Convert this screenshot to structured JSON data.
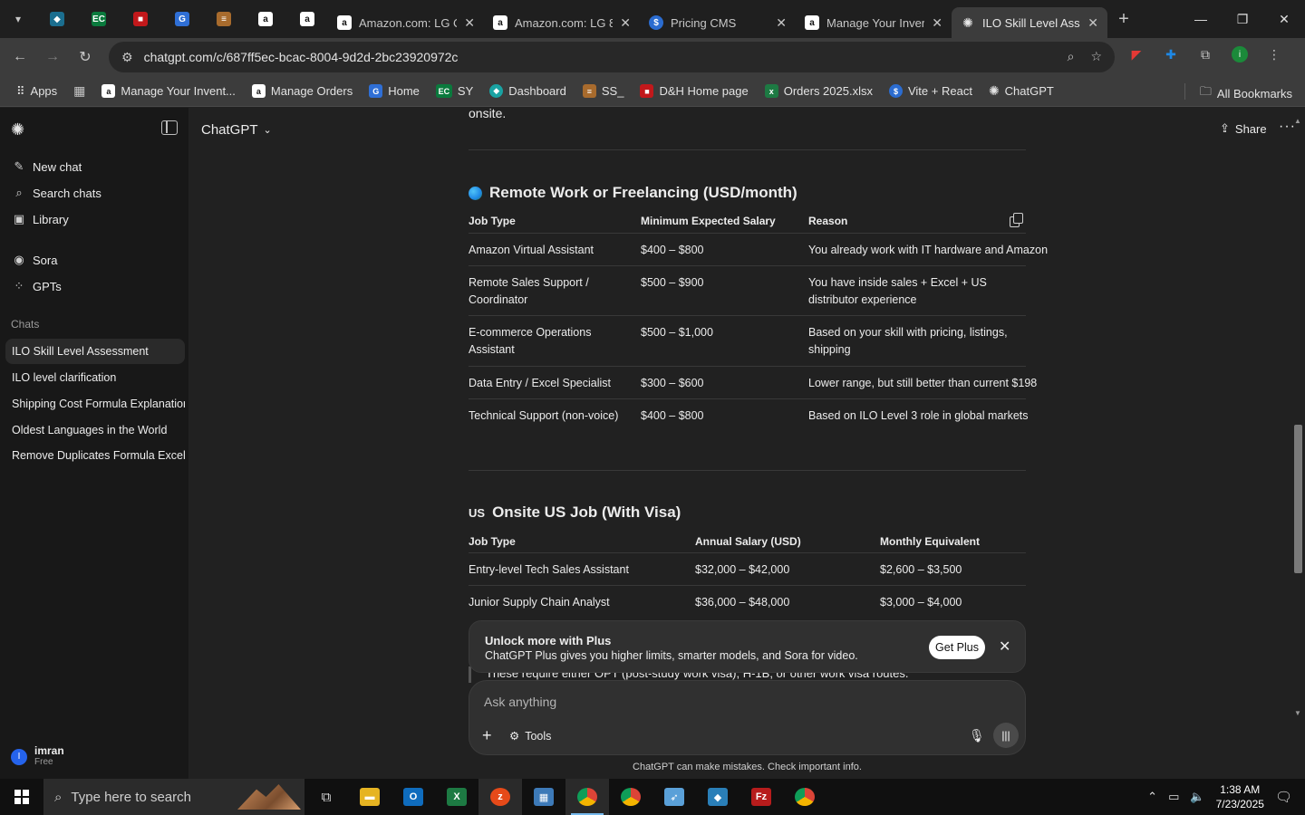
{
  "browser": {
    "tabs": [
      {
        "title": "Amazon.com: LG C",
        "icon": "amazon-icon",
        "active": false
      },
      {
        "title": "Amazon.com: LG 8",
        "icon": "amazon-icon",
        "active": false
      },
      {
        "title": "Pricing CMS",
        "icon": "dollar-icon",
        "active": false
      },
      {
        "title": "Manage Your Inver",
        "icon": "amazon-icon",
        "active": false
      },
      {
        "title": "ILO Skill Level Asse",
        "icon": "chatgpt-icon",
        "active": true
      }
    ],
    "url": "chatgpt.com/c/687ff5ec-bcac-8004-9d2d-2bc23920972c",
    "bookmarks": [
      {
        "label": "Apps",
        "icon": "apps-icon"
      },
      {
        "label": "Manage Your Invent...",
        "icon": "amazon-icon"
      },
      {
        "label": "Manage Orders",
        "icon": "amazon-icon"
      },
      {
        "label": "Home",
        "icon": "home-icon"
      },
      {
        "label": "SY",
        "icon": "ec-icon"
      },
      {
        "label": "Dashboard",
        "icon": "dashboard-icon"
      },
      {
        "label": "SS_",
        "icon": "ss-icon"
      },
      {
        "label": "D&H Home page",
        "icon": "dh-icon"
      },
      {
        "label": "Orders 2025.xlsx",
        "icon": "excel-icon"
      },
      {
        "label": "Vite + React",
        "icon": "vite-icon"
      },
      {
        "label": "ChatGPT",
        "icon": "chatgpt-icon"
      }
    ],
    "all_bookmarks": "All Bookmarks"
  },
  "sidebar": {
    "new_chat": "New chat",
    "search_chats": "Search chats",
    "library": "Library",
    "sora": "Sora",
    "gpts": "GPTs",
    "chats_label": "Chats",
    "chats": [
      "ILO Skill Level Assessment",
      "ILO level clarification",
      "Shipping Cost Formula Explanation",
      "Oldest Languages in the World",
      "Remove Duplicates Formula Excel"
    ],
    "user_initial": "I",
    "user_name": "imran",
    "user_plan": "Free"
  },
  "header": {
    "model": "ChatGPT",
    "share": "Share"
  },
  "content": {
    "fragment": "onsite.",
    "remote": {
      "title": "Remote Work or Freelancing (USD/month)",
      "headers": [
        "Job Type",
        "Minimum Expected Salary",
        "Reason"
      ],
      "rows": [
        [
          "Amazon Virtual Assistant",
          "$400 – $800",
          "You already work with IT hardware and Amazon"
        ],
        [
          "Remote Sales Support / Coordinator",
          "$500 – $900",
          "You have inside sales + Excel + US distributor experience"
        ],
        [
          "E-commerce Operations Assistant",
          "$500 – $1,000",
          "Based on your skill with pricing, listings, shipping"
        ],
        [
          "Data Entry / Excel Specialist",
          "$300 – $600",
          "Lower range, but still better than current $198"
        ],
        [
          "Technical Support (non-voice)",
          "$400 – $800",
          "Based on ILO Level 3 role in global markets"
        ]
      ]
    },
    "onsite": {
      "flag": "US",
      "title": "Onsite US Job (With Visa)",
      "headers": [
        "Job Type",
        "Annual Salary (USD)",
        "Monthly Equivalent"
      ],
      "rows": [
        [
          "Entry-level Tech Sales Assistant",
          "$32,000 – $42,000",
          "$2,600 – $3,500"
        ],
        [
          "Junior Supply Chain Analyst",
          "$36,000 – $48,000",
          "$3,000 – $4,000"
        ]
      ]
    },
    "peek_text": "These require either OPT (post-study work visa), H-1B, or other work visa routes."
  },
  "upsell": {
    "title": "Unlock more with Plus",
    "subtitle": "ChatGPT Plus gives you higher limits, smarter models, and Sora for video.",
    "button": "Get Plus"
  },
  "composer": {
    "placeholder": "Ask anything",
    "tools": "Tools"
  },
  "disclaimer": "ChatGPT can make mistakes. Check important info.",
  "taskbar": {
    "search_placeholder": "Type here to search",
    "time": "1:38 AM",
    "date": "7/23/2025"
  }
}
